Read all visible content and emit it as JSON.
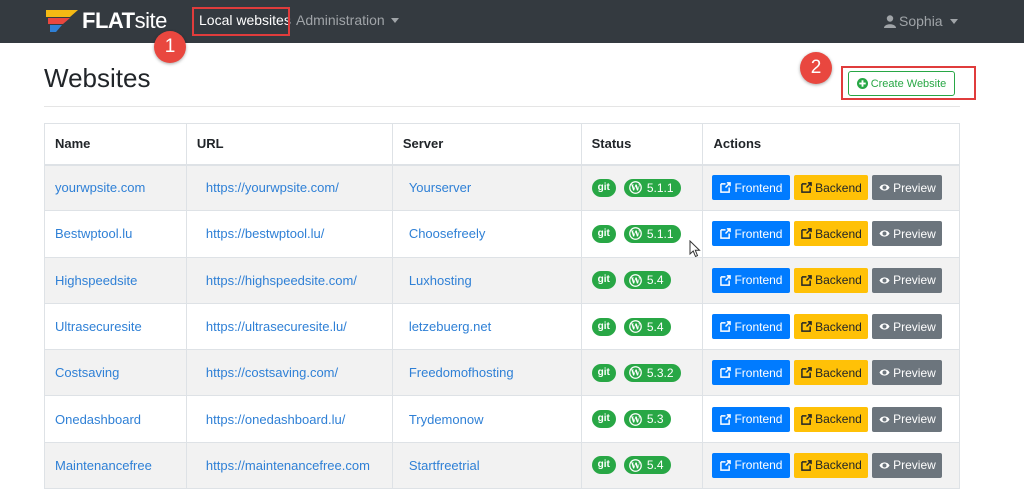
{
  "navbar": {
    "brand_bold": "FLAT",
    "brand_light": "site",
    "nav_local": "Local websites",
    "nav_admin": "Administration",
    "user": "Sophia"
  },
  "annotations": {
    "one": "1",
    "two": "2"
  },
  "page": {
    "title": "Websites",
    "create_button": "Create Website"
  },
  "table": {
    "headers": {
      "name": "Name",
      "url": "URL",
      "server": "Server",
      "status": "Status",
      "actions": "Actions"
    },
    "git_label": "git",
    "action_labels": {
      "frontend": "Frontend",
      "backend": "Backend",
      "preview": "Preview"
    },
    "rows": [
      {
        "name": "yourwpsite.com",
        "url": "https://yourwpsite.com/",
        "server": "Yourserver",
        "wp_version": "5.1.1"
      },
      {
        "name": "Bestwptool.lu",
        "url": "https://bestwptool.lu/",
        "server": "Choosefreely",
        "wp_version": "5.1.1"
      },
      {
        "name": "Highspeedsite",
        "url": "https://highspeedsite.com/",
        "server": "Luxhosting",
        "wp_version": "5.4"
      },
      {
        "name": "Ultrasecuresite",
        "url": "https://ultrasecuresite.lu/",
        "server": "letzebuerg.net",
        "wp_version": "5.4"
      },
      {
        "name": "Costsaving",
        "url": "https://costsaving.com/",
        "server": "Freedomofhosting",
        "wp_version": "5.3.2"
      },
      {
        "name": "Onedashboard",
        "url": "https://onedashboard.lu/",
        "server": "Trydemonow",
        "wp_version": "5.3"
      },
      {
        "name": "Maintenancefree",
        "url": "https://maintenancefree.com",
        "server": "Startfreetrial",
        "wp_version": "5.4"
      }
    ]
  },
  "colors": {
    "navbar": "#343a40",
    "success": "#28a745",
    "primary": "#007bff",
    "warning": "#ffc107",
    "secondary": "#6c757d",
    "annotation": "#e03c3c"
  }
}
